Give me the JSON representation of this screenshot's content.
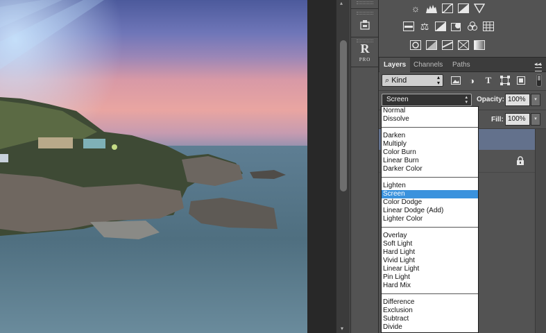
{
  "dock": {
    "pro_logo": "R",
    "pro_logo_sub": "PRO"
  },
  "adjustments": {
    "row1": [
      "brightness-contrast-icon",
      "levels-icon",
      "curves-icon",
      "exposure-icon",
      "vibrance-icon"
    ],
    "row2": [
      "hue-saturation-icon",
      "color-balance-icon",
      "black-white-icon",
      "photo-filter-icon",
      "channel-mixer-icon",
      "color-lookup-icon"
    ],
    "row3": [
      "invert-icon",
      "posterize-icon",
      "threshold-icon",
      "selective-color-icon",
      "gradient-map-icon"
    ]
  },
  "tabs": {
    "layers": "Layers",
    "channels": "Channels",
    "paths": "Paths",
    "close": "◂◂"
  },
  "filter": {
    "kind": "Kind",
    "kind_icon": "⌕"
  },
  "blend": {
    "current": "Screen",
    "opacity_label": "Opacity:",
    "opacity_value": "100%",
    "fill_label": "Fill:",
    "fill_value": "100%"
  },
  "blend_modes": [
    {
      "label": "Normal"
    },
    {
      "label": "Dissolve"
    },
    {
      "sep": true
    },
    {
      "label": "Darken"
    },
    {
      "label": "Multiply"
    },
    {
      "label": "Color Burn"
    },
    {
      "label": "Linear Burn"
    },
    {
      "label": "Darker Color"
    },
    {
      "sep": true
    },
    {
      "label": "Lighten"
    },
    {
      "label": "Screen",
      "selected": true
    },
    {
      "label": "Color Dodge"
    },
    {
      "label": "Linear Dodge (Add)"
    },
    {
      "label": "Lighter Color"
    },
    {
      "sep": true
    },
    {
      "label": "Overlay"
    },
    {
      "label": "Soft Light"
    },
    {
      "label": "Hard Light"
    },
    {
      "label": "Vivid Light"
    },
    {
      "label": "Linear Light"
    },
    {
      "label": "Pin Light"
    },
    {
      "label": "Hard Mix"
    },
    {
      "sep": true
    },
    {
      "label": "Difference"
    },
    {
      "label": "Exclusion"
    },
    {
      "label": "Subtract"
    },
    {
      "label": "Divide"
    }
  ]
}
